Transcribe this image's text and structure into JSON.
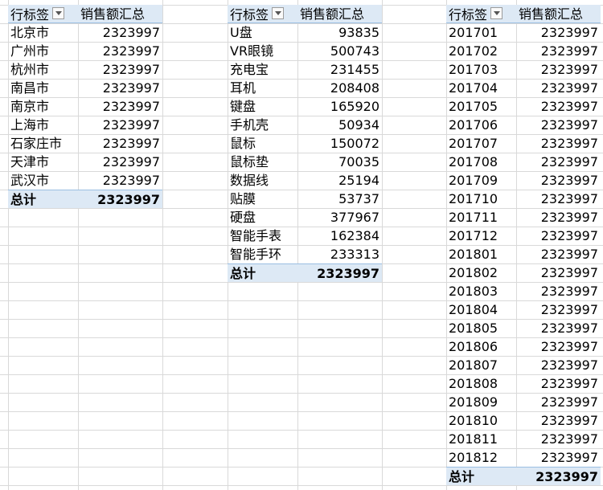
{
  "pivot_city": {
    "header_label": "行标签",
    "header_value": "销售额汇总",
    "rows": [
      {
        "label": "北京市",
        "value": "2323997"
      },
      {
        "label": "广州市",
        "value": "2323997"
      },
      {
        "label": "杭州市",
        "value": "2323997"
      },
      {
        "label": "南昌市",
        "value": "2323997"
      },
      {
        "label": "南京市",
        "value": "2323997"
      },
      {
        "label": "上海市",
        "value": "2323997"
      },
      {
        "label": "石家庄市",
        "value": "2323997"
      },
      {
        "label": "天津市",
        "value": "2323997"
      },
      {
        "label": "武汉市",
        "value": "2323997"
      }
    ],
    "total_label": "总计",
    "total_value": "2323997"
  },
  "pivot_product": {
    "header_label": "行标签",
    "header_value": "销售额汇总",
    "rows": [
      {
        "label": "U盘",
        "value": "93835"
      },
      {
        "label": "VR眼镜",
        "value": "500743"
      },
      {
        "label": "充电宝",
        "value": "231455"
      },
      {
        "label": "耳机",
        "value": "208408"
      },
      {
        "label": "键盘",
        "value": "165920"
      },
      {
        "label": "手机壳",
        "value": "50934"
      },
      {
        "label": "鼠标",
        "value": "150072"
      },
      {
        "label": "鼠标垫",
        "value": "70035"
      },
      {
        "label": "数据线",
        "value": "25194"
      },
      {
        "label": "贴膜",
        "value": "53737"
      },
      {
        "label": "硬盘",
        "value": "377967"
      },
      {
        "label": "智能手表",
        "value": "162384"
      },
      {
        "label": "智能手环",
        "value": "233313"
      }
    ],
    "total_label": "总计",
    "total_value": "2323997"
  },
  "pivot_month": {
    "header_label": "行标签",
    "header_value": "销售额汇总",
    "rows": [
      {
        "label": "201701",
        "value": "2323997"
      },
      {
        "label": "201702",
        "value": "2323997"
      },
      {
        "label": "201703",
        "value": "2323997"
      },
      {
        "label": "201704",
        "value": "2323997"
      },
      {
        "label": "201705",
        "value": "2323997"
      },
      {
        "label": "201706",
        "value": "2323997"
      },
      {
        "label": "201707",
        "value": "2323997"
      },
      {
        "label": "201708",
        "value": "2323997"
      },
      {
        "label": "201709",
        "value": "2323997"
      },
      {
        "label": "201710",
        "value": "2323997"
      },
      {
        "label": "201711",
        "value": "2323997"
      },
      {
        "label": "201712",
        "value": "2323997"
      },
      {
        "label": "201801",
        "value": "2323997"
      },
      {
        "label": "201802",
        "value": "2323997"
      },
      {
        "label": "201803",
        "value": "2323997"
      },
      {
        "label": "201804",
        "value": "2323997"
      },
      {
        "label": "201805",
        "value": "2323997"
      },
      {
        "label": "201806",
        "value": "2323997"
      },
      {
        "label": "201807",
        "value": "2323997"
      },
      {
        "label": "201808",
        "value": "2323997"
      },
      {
        "label": "201809",
        "value": "2323997"
      },
      {
        "label": "201810",
        "value": "2323997"
      },
      {
        "label": "201811",
        "value": "2323997"
      },
      {
        "label": "201812",
        "value": "2323997"
      }
    ],
    "total_label": "总计",
    "total_value": "2323997"
  }
}
